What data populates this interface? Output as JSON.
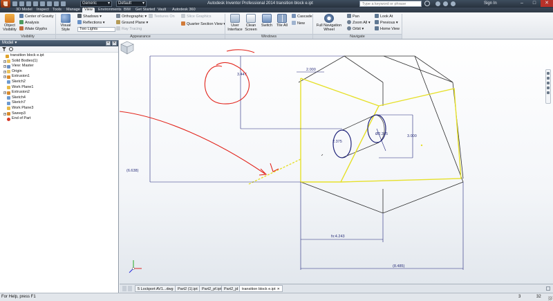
{
  "titlebar": {
    "workspace_combo": "Generic",
    "style_combo": "Default",
    "title": "Autodesk Inventor Professional 2014   transition block e.ipt",
    "search_placeholder": "Type a keyword or phrase",
    "sign_in": "Sign In"
  },
  "tabs": [
    "3D Model",
    "Inspect",
    "Tools",
    "Manage",
    "View",
    "Environments",
    "BIM",
    "Get Started",
    "Vault",
    "Autodesk 360"
  ],
  "active_tab": "View",
  "ribbon": {
    "visibility": {
      "label": "Visibility",
      "object_visibility": "Object\nVisibility",
      "items": [
        "Center of Gravity",
        "Analysis",
        "iMate Glyphs"
      ]
    },
    "appearance": {
      "label": "Appearance",
      "visual_style": "Visual Style",
      "shadows": "Shadows",
      "reflections": "Reflections",
      "lights_combo": "Two Lights",
      "orthographic": "Orthographic",
      "ground_plane": "Ground Plane",
      "ray_tracing": "Ray Tracing",
      "texture_on": "Textures On",
      "slice_graphics": "Slice Graphics",
      "quarter_section": "Quarter Section View"
    },
    "windows": {
      "label": "Windows",
      "user_interface": "User\nInterface",
      "clean_screen": "Clean\nScreen",
      "switch": "Switch",
      "tile_all": "Tile All",
      "cascade": "Cascade",
      "new": "New"
    },
    "navigate": {
      "label": "Navigate",
      "full_nav_wheel": "Full Navigation\nWheel",
      "pan": "Pan",
      "zoom_all": "Zoom All",
      "orbit": "Orbit",
      "look_at": "Look At",
      "previous": "Previous",
      "home_view": "Home View"
    }
  },
  "browser": {
    "title": "Model",
    "tree": [
      {
        "label": "transition block e.ipt",
        "level": 0,
        "expander": "",
        "icon": "part",
        "color": "#e0a42c"
      },
      {
        "label": "Solid Bodies(1)",
        "level": 1,
        "expander": "+",
        "icon": "folder",
        "color": "#e9c15a"
      },
      {
        "label": "View: Master",
        "level": 1,
        "expander": "+",
        "icon": "view",
        "color": "#6b8fc4"
      },
      {
        "label": "Origin",
        "level": 1,
        "expander": "+",
        "icon": "folder",
        "color": "#e9c15a"
      },
      {
        "label": "Extrusion1",
        "level": 1,
        "expander": "+",
        "icon": "extrude",
        "color": "#d88a2b"
      },
      {
        "label": "Sketch2",
        "level": 1,
        "expander": "",
        "icon": "sketch",
        "color": "#6d9ad0"
      },
      {
        "label": "Work Plane1",
        "level": 1,
        "expander": "",
        "icon": "plane",
        "color": "#e7b948"
      },
      {
        "label": "Extrusion2",
        "level": 1,
        "expander": "+",
        "icon": "extrude",
        "color": "#d88a2b"
      },
      {
        "label": "Sketch4",
        "level": 1,
        "expander": "",
        "icon": "sketch",
        "color": "#6d9ad0"
      },
      {
        "label": "Sketch7",
        "level": 1,
        "expander": "",
        "icon": "sketch",
        "color": "#6d9ad0"
      },
      {
        "label": "Work Plane3",
        "level": 1,
        "expander": "",
        "icon": "plane",
        "color": "#e7b948"
      },
      {
        "label": "Sweep3",
        "level": 1,
        "expander": "+",
        "icon": "sweep",
        "color": "#d88a2b"
      },
      {
        "label": "End of Part",
        "level": 1,
        "expander": "",
        "icon": "end",
        "color": "#d63a2a"
      }
    ]
  },
  "dimensions": {
    "d_top": "2.000",
    "d_left_small": "3.447",
    "d_left_big": "(6.638)",
    "d_circle_left": "2.375",
    "d_circle_right": "Ø2.375",
    "d_vertical_right": "3.000",
    "d_bottom_inner": "fx:4.243",
    "d_bottom_outer": "(8.485)"
  },
  "doc_tabs": [
    "5 Lockport AV1...dwg",
    "Part2 (1).ipt",
    "Part2_pf.ipt",
    "Part2_jd",
    "transition block e.ipt"
  ],
  "active_doc_tab": "transition block e.ipt",
  "status": {
    "help_text": "For Help, press F1",
    "count1": "3",
    "count2": "32"
  },
  "colors": {
    "accent_tab": "#eef1f5",
    "titlebar": "#2f3b49",
    "model_edges": "#2b2b2b",
    "sketch_yellow": "#e6e02a",
    "dimension_blue": "#1f237a",
    "annotation_red": "#e2231a"
  }
}
